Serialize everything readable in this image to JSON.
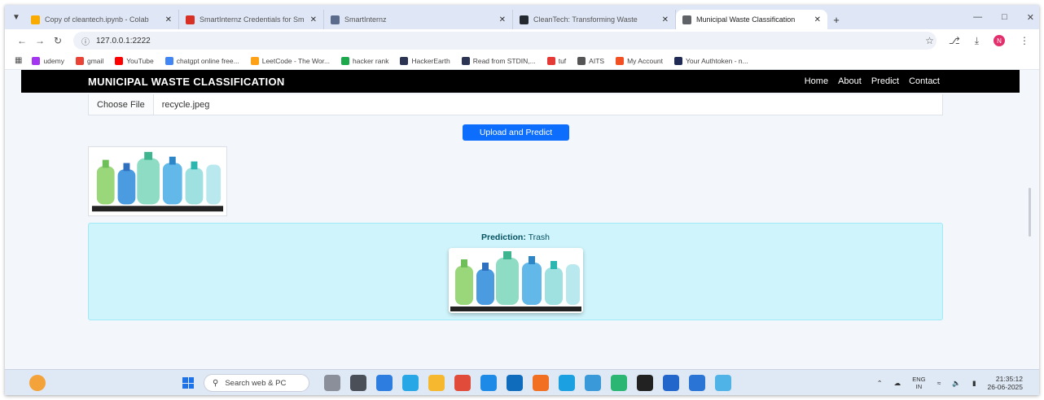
{
  "browser": {
    "tabs": [
      {
        "title": "Copy of cleantech.ipynb - Colab",
        "color": "#f9ab00",
        "active": false
      },
      {
        "title": "SmartInternz Credentials for Sm",
        "color": "#d93025",
        "active": false
      },
      {
        "title": "SmartInternz",
        "color": "#5b6b8c",
        "active": false
      },
      {
        "title": "CleanTech: Transforming Waste",
        "color": "#24292f",
        "active": false
      },
      {
        "title": "Municipal Waste Classification",
        "color": "#5f6368",
        "active": true
      }
    ],
    "new_tab": "+",
    "url": "127.0.0.1:2222",
    "bookmarks": [
      {
        "label": "udemy",
        "color": "#a435f0"
      },
      {
        "label": "gmail",
        "color": "#ea4335"
      },
      {
        "label": "YouTube",
        "color": "#ff0000"
      },
      {
        "label": "chatgpt online free...",
        "color": "#4285f4"
      },
      {
        "label": "LeetCode - The Wor...",
        "color": "#ffa116"
      },
      {
        "label": "hacker rank",
        "color": "#1ba94c"
      },
      {
        "label": "HackerEarth",
        "color": "#2c3454"
      },
      {
        "label": "Read from STDIN,...",
        "color": "#2c3454"
      },
      {
        "label": "tuf",
        "color": "#e53935"
      },
      {
        "label": "AITS",
        "color": "#555555"
      },
      {
        "label": "My Account",
        "color": "#f25022"
      },
      {
        "label": "Your Authtoken - n...",
        "color": "#1f2a55"
      }
    ],
    "profile_initial": "N"
  },
  "site": {
    "brand": "MUNICIPAL WASTE CLASSIFICATION",
    "nav": [
      "Home",
      "About",
      "Predict",
      "Contact"
    ],
    "file_button": "Choose File",
    "file_name": "recycle.jpeg",
    "upload_button": "Upload and Predict",
    "prediction_label": "Prediction:",
    "prediction_value": "Trash"
  },
  "taskbar": {
    "search_placeholder": "Search web & PC",
    "lang_top": "ENG",
    "lang_bottom": "IN",
    "time": "21:35:12",
    "date": "26-06-2025",
    "app_colors": [
      "#8a8f99",
      "#4a4f58",
      "#2d7de0",
      "#27a7e6",
      "#f5b82e",
      "#e04b3a",
      "#1e8ae8",
      "#0f6cbd",
      "#f26f21",
      "#1ba1e2",
      "#3a9ad9",
      "#2bb673",
      "#222222",
      "#2266cc",
      "#2a74d6",
      "#4fb3e8"
    ]
  },
  "colors": {
    "navbar": "#000000",
    "primary_button": "#0d6efd",
    "alert_bg": "#cff4fc"
  }
}
